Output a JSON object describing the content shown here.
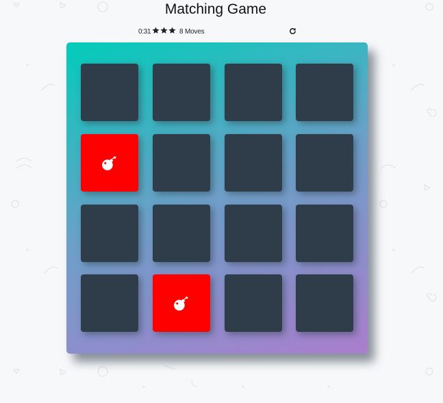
{
  "title": "Matching Game",
  "score": {
    "timer": "0:31",
    "stars": 3,
    "moves": "8 Moves"
  },
  "deck": {
    "cards": [
      {
        "state": "closed"
      },
      {
        "state": "closed"
      },
      {
        "state": "closed"
      },
      {
        "state": "closed"
      },
      {
        "state": "open",
        "icon": "bomb-icon"
      },
      {
        "state": "closed"
      },
      {
        "state": "closed"
      },
      {
        "state": "closed"
      },
      {
        "state": "closed"
      },
      {
        "state": "closed"
      },
      {
        "state": "closed"
      },
      {
        "state": "closed"
      },
      {
        "state": "closed"
      },
      {
        "state": "open",
        "icon": "bomb-icon"
      },
      {
        "state": "closed"
      },
      {
        "state": "closed"
      }
    ]
  },
  "colors": {
    "card_back": "#2e3d49",
    "card_open": "#ff0000",
    "deck_gradient_start": "#02ccba",
    "deck_gradient_end": "#aa7ecd"
  }
}
